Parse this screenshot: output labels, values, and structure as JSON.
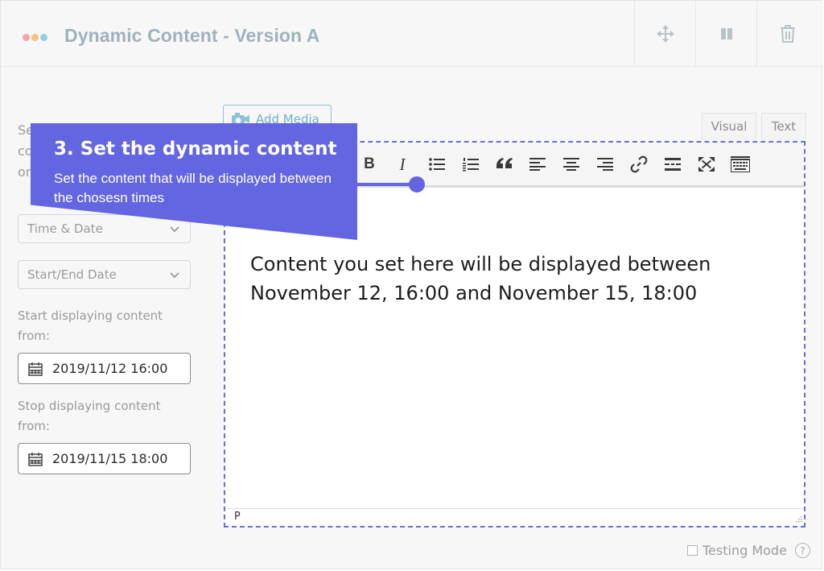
{
  "header": {
    "title": "Dynamic Content - Version A",
    "dot_colors": [
      "#f3a5a5",
      "#f6c37b",
      "#8fd0ef"
    ],
    "move_icon": "move-arrows-icon",
    "pause_icon": "pause-icon",
    "delete_icon": "trash-icon"
  },
  "sidebar": {
    "intro_lines": [
      "Se",
      "co",
      "on"
    ],
    "schedule_type": "Time & Date",
    "range_type": "Start/End Date",
    "start_label": "Start displaying content from:",
    "start_value": "2019/11/12 16:00",
    "stop_label": "Stop displaying content from:",
    "stop_value": "2019/11/15 18:00"
  },
  "editor": {
    "add_media_label": "Add Media",
    "tabs": {
      "visual": "Visual",
      "text": "Text"
    },
    "toolbar": [
      "bold",
      "italic",
      "bullet-list",
      "numbered-list",
      "blockquote",
      "align-left",
      "align-center",
      "align-right",
      "link",
      "read-more",
      "fullscreen",
      "toolbar-toggle"
    ],
    "bold_label": "B",
    "italic_label": "I",
    "content": "Content you set here will be displayed between November 12, 16:00 and November 15, 18:00",
    "status_path": "P"
  },
  "tooltip": {
    "title": "3. Set the dynamic content",
    "body": "Set the content that will be displayed between the chosesn times",
    "color": "#6366e0"
  },
  "footer": {
    "testing_mode_label": "Testing Mode",
    "help_label": "?"
  }
}
